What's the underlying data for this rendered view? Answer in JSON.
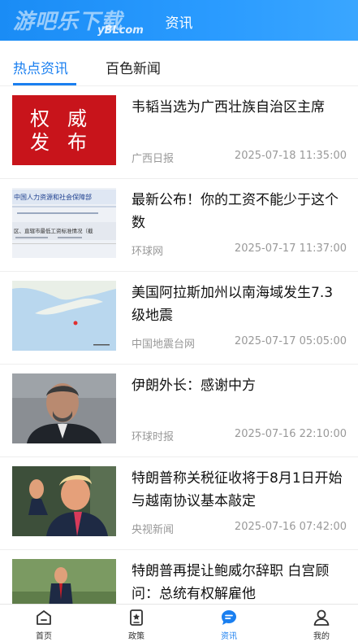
{
  "header": {
    "title": "资讯",
    "watermark_cn": "游吧乐下载",
    "watermark_en": "yBLcom"
  },
  "tabs": [
    {
      "label": "热点资讯",
      "active": true
    },
    {
      "label": "百色新闻",
      "active": false
    }
  ],
  "colors": {
    "accent": "#1a7ff0",
    "header": "#2a9bff"
  },
  "news": [
    {
      "title": "韦韬当选为广西壮族自治区主席",
      "source": "广西日报",
      "time": "2025-07-18 11:35:00",
      "thumb": "authority-release",
      "thumb_text": [
        "权",
        "威",
        "发",
        "布"
      ]
    },
    {
      "title": "最新公布！你的工资不能少于这个数",
      "source": "环球网",
      "time": "2025-07-17 11:37:00",
      "thumb": "document",
      "thumb_text": [
        "中国人力资源和社会保障部",
        "区、直辖市最低工资标准情况（截"
      ]
    },
    {
      "title": "美国阿拉斯加州以南海域发生7.3级地震",
      "source": "中国地震台网",
      "time": "2025-07-17 05:05:00",
      "thumb": "map"
    },
    {
      "title": "伊朗外长：感谢中方",
      "source": "环球时报",
      "time": "2025-07-16 22:10:00",
      "thumb": "portrait"
    },
    {
      "title": "特朗普称关税征收将于8月1日开始 与越南协议基本敲定",
      "source": "央视新闻",
      "time": "2025-07-16 07:42:00",
      "thumb": "speaker"
    },
    {
      "title": "特朗普再提让鲍威尔辞职 白宫顾问：总统有权解雇他",
      "source": "",
      "time": "",
      "thumb": "outdoor"
    }
  ],
  "bottom_nav": [
    {
      "label": "首页",
      "icon": "home-icon",
      "active": false
    },
    {
      "label": "政策",
      "icon": "policy-icon",
      "active": false
    },
    {
      "label": "资讯",
      "icon": "news-chat-icon",
      "active": true
    },
    {
      "label": "我的",
      "icon": "profile-icon",
      "active": false
    }
  ]
}
